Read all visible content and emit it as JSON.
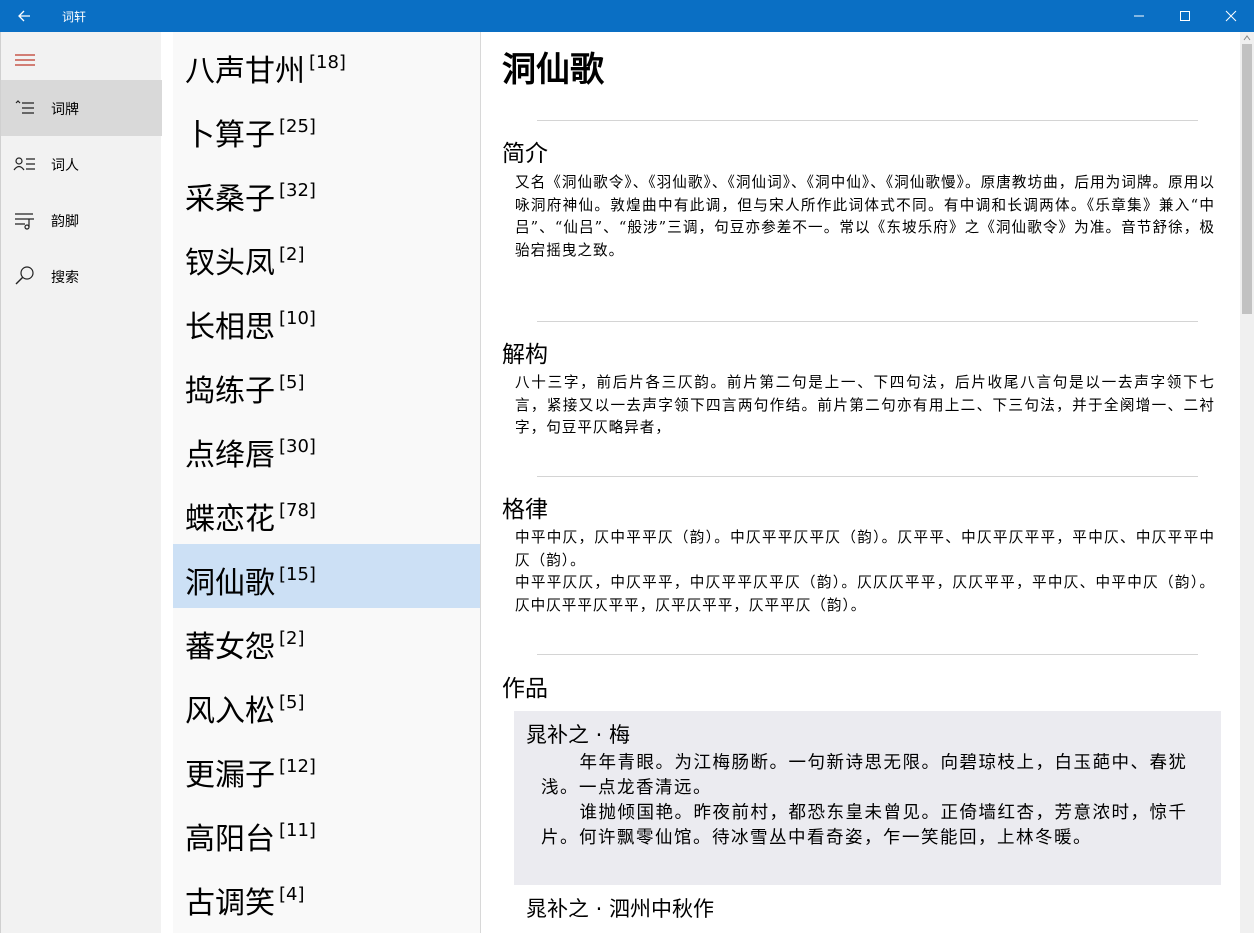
{
  "window": {
    "title": "词轩",
    "accent": "#0a6fc4"
  },
  "nav": {
    "items": [
      {
        "label": "词牌",
        "icon": "list-icon"
      },
      {
        "label": "词人",
        "icon": "people-list-icon"
      },
      {
        "label": "韵脚",
        "icon": "music-list-icon"
      },
      {
        "label": "搜索",
        "icon": "search-icon"
      }
    ]
  },
  "list": {
    "items": [
      {
        "name": "八声甘州",
        "count": "[18]"
      },
      {
        "name": "卜算子",
        "count": "[25]"
      },
      {
        "name": "采桑子",
        "count": "[32]"
      },
      {
        "name": "钗头凤",
        "count": "[2]"
      },
      {
        "name": "长相思",
        "count": "[10]"
      },
      {
        "name": "捣练子",
        "count": "[5]"
      },
      {
        "name": "点绛唇",
        "count": "[30]"
      },
      {
        "name": "蝶恋花",
        "count": "[78]"
      },
      {
        "name": "洞仙歌",
        "count": "[15]"
      },
      {
        "name": "蕃女怨",
        "count": "[2]"
      },
      {
        "name": "风入松",
        "count": "[5]"
      },
      {
        "name": "更漏子",
        "count": "[12]"
      },
      {
        "name": "高阳台",
        "count": "[11]"
      },
      {
        "name": "古调笑",
        "count": "[4]"
      }
    ],
    "selected_index": 8
  },
  "detail": {
    "title": "洞仙歌",
    "intro": {
      "heading": "简介",
      "text": "又名《洞仙歌令》、《羽仙歌》、《洞仙词》、《洞中仙》、《洞仙歌慢》。原唐教坊曲，后用为词牌。原用以咏洞府神仙。敦煌曲中有此调，但与宋人所作此词体式不同。有中调和长调两体。《乐章集》兼入“中吕”、“仙吕”、“般涉”三调，句豆亦参差不一。常以《东坡乐府》之《洞仙歌令》为准。音节舒徐，极骀宕摇曳之致。"
    },
    "structure": {
      "heading": "解构",
      "text": "八十三字，前后片各三仄韵。前片第二句是上一、下四句法，后片收尾八言句是以一去声字领下七言，紧接又以一去声字领下四言两句作结。前片第二句亦有用上二、下三句法，并于全阕增一、二衬字，句豆平仄略异者，"
    },
    "meter": {
      "heading": "格律",
      "line1": "中平中仄，仄中平平仄（韵）。中仄平平仄平仄（韵）。仄平平、中仄平仄平平，平中仄、中仄平平中仄（韵）。",
      "line2": "中平平仄仄，中仄平平，中仄平平仄平仄（韵）。仄仄仄平平，仄仄平平，平中仄、中平中仄（韵）。仄中仄平平仄平平，仄平仄平平，仄平平仄（韵）。"
    },
    "works": {
      "heading": "作品",
      "items": [
        {
          "title": "晁补之 · 梅",
          "para1": "年年青眼。为江梅肠断。一句新诗思无限。向碧琼枝上，白玉葩中、春犹浅。一点龙香清远。",
          "para2": "谁抛倾国艳。昨夜前村，都恐东皇未曾见。正倚墙红杏，芳意浓时，惊千片。何许飘零仙馆。待冰雪丛中看奇姿，乍一笑能回，上林冬暖。"
        },
        {
          "title": "晁补之 · 泗州中秋作"
        }
      ]
    }
  }
}
